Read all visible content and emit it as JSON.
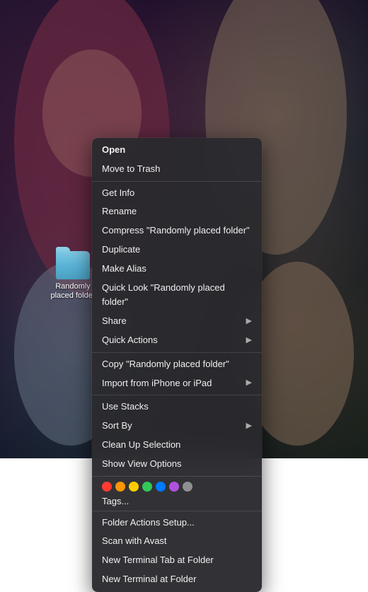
{
  "background": {
    "description": "Movie poster background"
  },
  "folder": {
    "label": "Randomly placed folder"
  },
  "contextMenu": {
    "items": [
      {
        "id": "open",
        "label": "Open",
        "bold": true,
        "separator_after": false,
        "has_arrow": false
      },
      {
        "id": "move-to-trash",
        "label": "Move to Trash",
        "bold": false,
        "separator_after": true,
        "has_arrow": false
      },
      {
        "id": "get-info",
        "label": "Get Info",
        "bold": false,
        "separator_after": false,
        "has_arrow": false
      },
      {
        "id": "rename",
        "label": "Rename",
        "bold": false,
        "separator_after": false,
        "has_arrow": false
      },
      {
        "id": "compress",
        "label": "Compress \"Randomly placed folder\"",
        "bold": false,
        "separator_after": false,
        "has_arrow": false
      },
      {
        "id": "duplicate",
        "label": "Duplicate",
        "bold": false,
        "separator_after": false,
        "has_arrow": false
      },
      {
        "id": "make-alias",
        "label": "Make Alias",
        "bold": false,
        "separator_after": false,
        "has_arrow": false
      },
      {
        "id": "quick-look",
        "label": "Quick Look \"Randomly placed folder\"",
        "bold": false,
        "separator_after": false,
        "has_arrow": false
      },
      {
        "id": "share",
        "label": "Share",
        "bold": false,
        "separator_after": false,
        "has_arrow": true
      },
      {
        "id": "quick-actions",
        "label": "Quick Actions",
        "bold": false,
        "separator_after": true,
        "has_arrow": true
      },
      {
        "id": "copy",
        "label": "Copy \"Randomly placed folder\"",
        "bold": false,
        "separator_after": false,
        "has_arrow": false
      },
      {
        "id": "import",
        "label": "Import from iPhone or iPad",
        "bold": false,
        "separator_after": true,
        "has_arrow": true
      },
      {
        "id": "use-stacks",
        "label": "Use Stacks",
        "bold": false,
        "separator_after": false,
        "has_arrow": false
      },
      {
        "id": "sort-by",
        "label": "Sort By",
        "bold": false,
        "separator_after": false,
        "has_arrow": true
      },
      {
        "id": "clean-up",
        "label": "Clean Up Selection",
        "bold": false,
        "separator_after": false,
        "has_arrow": false
      },
      {
        "id": "show-view-options",
        "label": "Show View Options",
        "bold": false,
        "separator_after": true,
        "has_arrow": false
      }
    ],
    "tags": {
      "label": "Tags...",
      "dots": [
        {
          "color": "#ff3b30",
          "name": "red"
        },
        {
          "color": "#ff9500",
          "name": "orange"
        },
        {
          "color": "#ffcc00",
          "name": "yellow"
        },
        {
          "color": "#34c759",
          "name": "green"
        },
        {
          "color": "#007aff",
          "name": "blue"
        },
        {
          "color": "#af52de",
          "name": "purple"
        },
        {
          "color": "#8e8e93",
          "name": "gray"
        }
      ]
    },
    "bottomItems": [
      {
        "id": "folder-actions",
        "label": "Folder Actions Setup...",
        "has_arrow": false
      },
      {
        "id": "scan-avast",
        "label": "Scan with Avast",
        "has_arrow": false
      },
      {
        "id": "new-terminal-tab",
        "label": "New Terminal Tab at Folder",
        "has_arrow": false
      },
      {
        "id": "new-terminal",
        "label": "New Terminal at Folder",
        "has_arrow": false
      }
    ]
  }
}
